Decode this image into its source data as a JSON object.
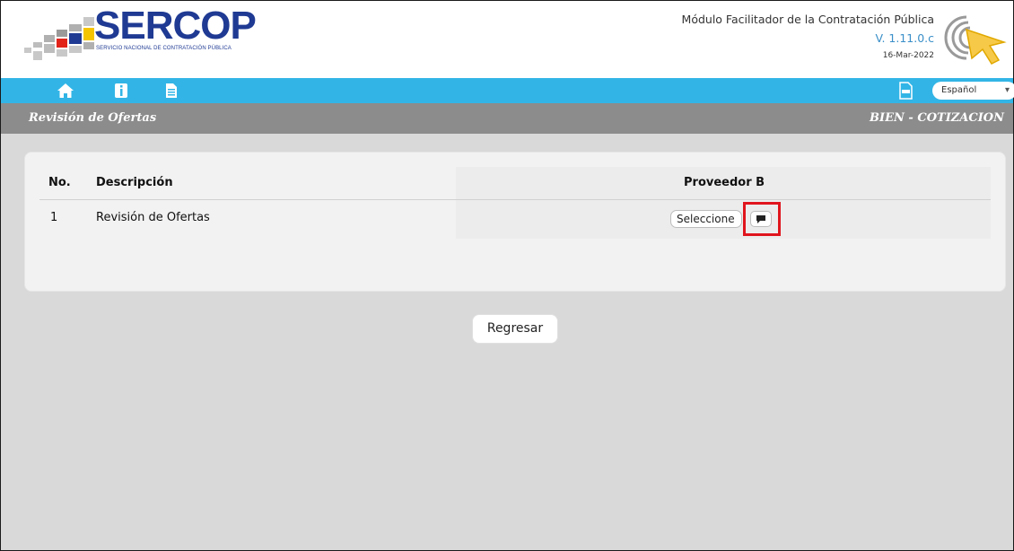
{
  "header": {
    "logo_text": "SERCOP",
    "logo_subtitle": "SERVICIO NACIONAL DE CONTRATACIÓN PÚBLICA",
    "module_title": "Módulo Facilitador de la Contratación Pública",
    "version": "V. 1.11.0.c",
    "date": "16-Mar-2022"
  },
  "navbar": {
    "icons": [
      "home-icon",
      "info-icon",
      "document-icon",
      "pdf-icon"
    ],
    "language": "Español"
  },
  "titlebar": {
    "left": "Revisión de Ofertas",
    "right": "BIEN - COTIZACION"
  },
  "table": {
    "headers": [
      "No.",
      "Descripción",
      "Proveedor B"
    ],
    "rows": [
      {
        "no": "1",
        "description": "Revisión de Ofertas",
        "select_label": "Seleccione"
      }
    ]
  },
  "actions": {
    "back_label": "Regresar"
  },
  "colors": {
    "navbar": "#32b5e6",
    "titlebar": "#8c8c8c",
    "background": "#d9d9d9",
    "brand_blue": "#1f3a93",
    "version_blue": "#3a8fc8",
    "highlight": "#e0151d"
  }
}
